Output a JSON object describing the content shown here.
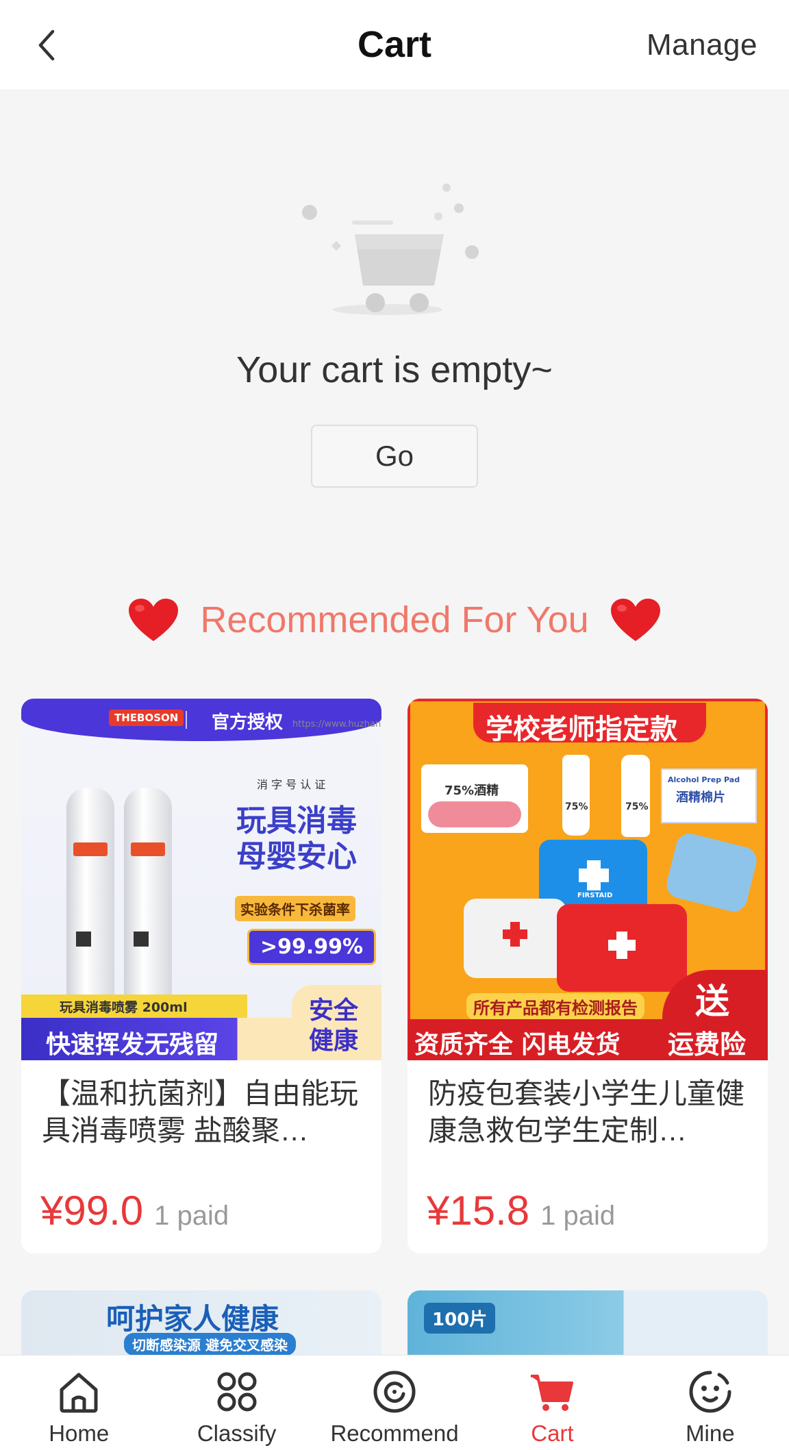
{
  "header": {
    "title": "Cart",
    "manage_label": "Manage"
  },
  "empty_state": {
    "message": "Your cart is empty~",
    "go_label": "Go"
  },
  "recommend": {
    "title": "Recommended For You"
  },
  "products": [
    {
      "title": "【温和抗菌剂】自由能玩具消毒喷雾 盐酸聚…",
      "price": "¥99.0",
      "paid": "1 paid",
      "image_text": {
        "brand": "THEBOSON",
        "auth": "官方授权",
        "watermark": "https://www.huzhan.com/ishop",
        "cert": "消 字 号 认 证",
        "headline1": "玩具消毒",
        "headline2": "母婴安心",
        "lab": "实验条件下杀菌率",
        "rate": ">99.99%",
        "product_name": "玩具消毒喷雾  200ml",
        "bottom": "快速挥发无残留",
        "safe1": "安全",
        "safe2": "健康"
      }
    },
    {
      "title": "防疫包套装小学生儿童健康急救包学生定制…",
      "price": "¥15.8",
      "paid": "1 paid",
      "image_text": {
        "banner": "学校老师指定款",
        "wipes": "75%酒精",
        "gel": "75%",
        "spray": "75%",
        "pad_title": "Alcohol Prep Pad",
        "pad_cn": "酒精棉片",
        "report": "所有产品都有检测报告",
        "bottom": "资质齐全  闪电发货",
        "gift1": "送",
        "gift2": "运费险",
        "kit": "FIRSTAID"
      }
    }
  ],
  "products_row2": [
    {
      "image_text": {
        "headline": "呵护家人健康",
        "sub": "切断感染源 避免交叉感染"
      }
    },
    {
      "image_text": {
        "badge": "100片"
      }
    }
  ],
  "bottom_nav": [
    {
      "label": "Home",
      "icon": "home-icon"
    },
    {
      "label": "Classify",
      "icon": "classify-icon"
    },
    {
      "label": "Recommend",
      "icon": "recommend-icon"
    },
    {
      "label": "Cart",
      "icon": "cart-icon",
      "active": true
    },
    {
      "label": "Mine",
      "icon": "mine-icon"
    }
  ],
  "colors": {
    "accent": "#e8383a",
    "recommend_title": "#f0786a",
    "background": "#f5f5f5"
  }
}
